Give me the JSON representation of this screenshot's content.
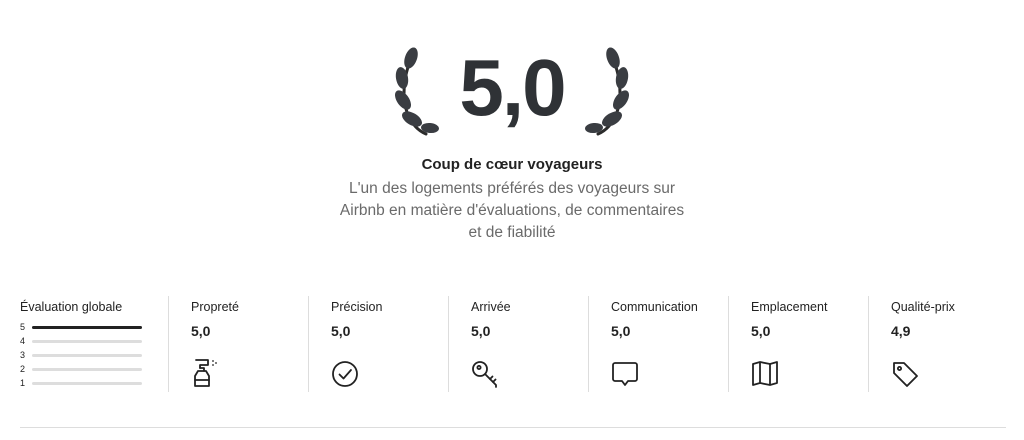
{
  "hero": {
    "score": "5,0",
    "badge_title": "Coup de cœur voyageurs",
    "badge_description": "L'un des logements préférés des voyageurs sur Airbnb en matière d'évaluations, de commentaires et de fiabilité"
  },
  "overall": {
    "title": "Évaluation globale",
    "distribution": [
      {
        "label": "5",
        "fraction": 1.0
      },
      {
        "label": "4",
        "fraction": 0.0
      },
      {
        "label": "3",
        "fraction": 0.0
      },
      {
        "label": "2",
        "fraction": 0.0
      },
      {
        "label": "1",
        "fraction": 0.0
      }
    ]
  },
  "categories": [
    {
      "label": "Propreté",
      "value": "5,0",
      "icon": "spray-bottle-icon"
    },
    {
      "label": "Précision",
      "value": "5,0",
      "icon": "check-circle-icon"
    },
    {
      "label": "Arrivée",
      "value": "5,0",
      "icon": "key-icon"
    },
    {
      "label": "Communication",
      "value": "5,0",
      "icon": "chat-bubble-icon"
    },
    {
      "label": "Emplacement",
      "value": "5,0",
      "icon": "map-icon"
    },
    {
      "label": "Qualité-prix",
      "value": "4,9",
      "icon": "price-tag-icon"
    }
  ],
  "colors": {
    "text": "#222222",
    "muted": "#6a6a6a",
    "score": "#2f3236",
    "divider": "#dddddd"
  }
}
